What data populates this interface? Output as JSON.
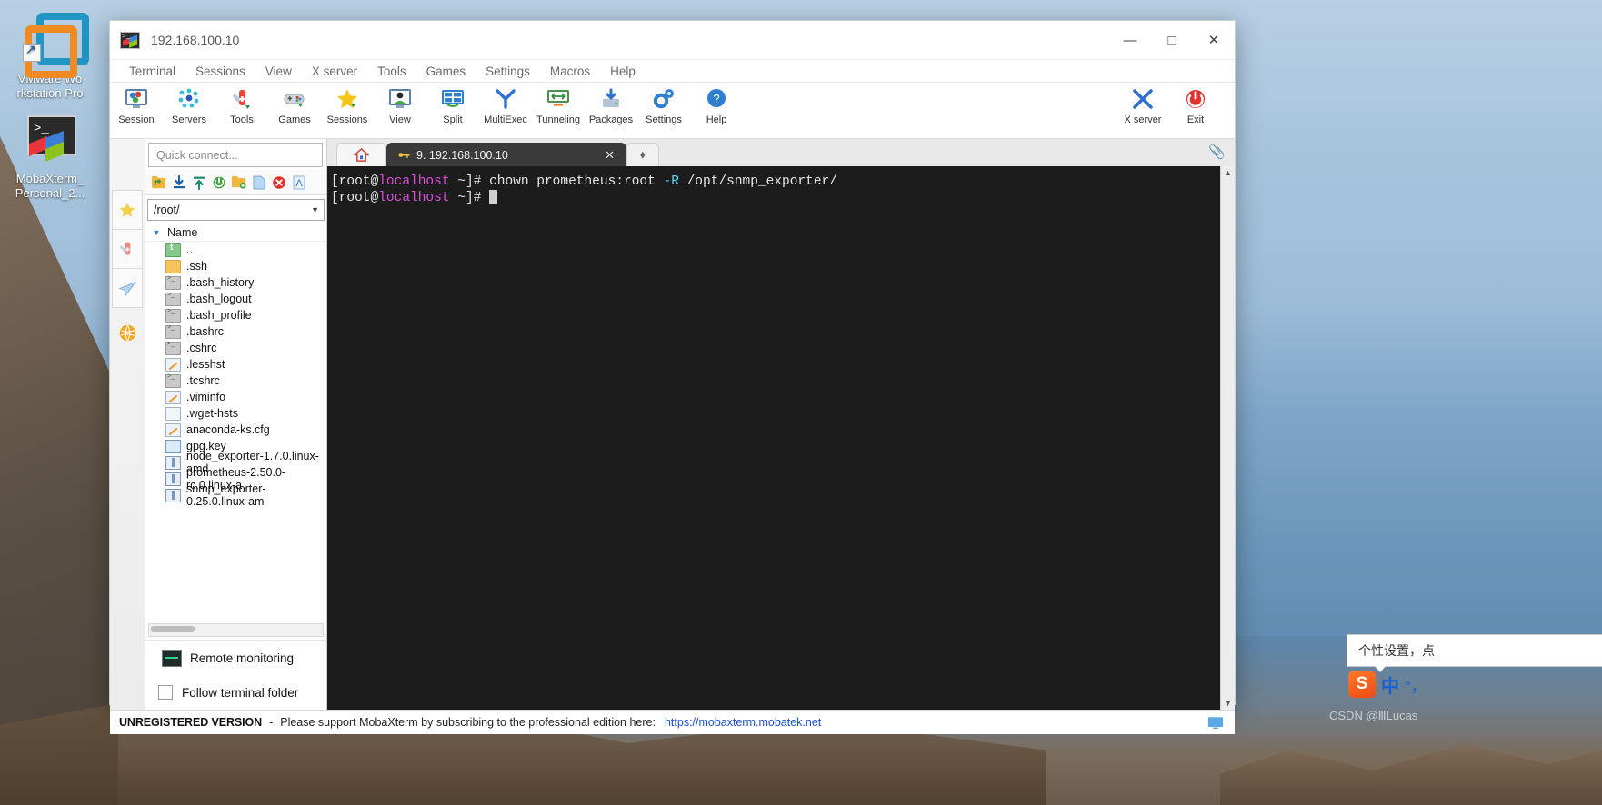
{
  "desktop": {
    "icons": [
      {
        "name": "vmware",
        "label": "VMware Wo\nrkstation Pro"
      },
      {
        "name": "mobaxterm",
        "label": "MobaXterm_\nPersonal_2..."
      }
    ]
  },
  "window": {
    "title": "192.168.100.10",
    "controls": {
      "minimize": "—",
      "maximize": "□",
      "close": "✕"
    },
    "menu": [
      "Terminal",
      "Sessions",
      "View",
      "X server",
      "Tools",
      "Games",
      "Settings",
      "Macros",
      "Help"
    ],
    "toolbar": [
      {
        "icon": "session-icon",
        "label": "Session"
      },
      {
        "icon": "servers-icon",
        "label": "Servers"
      },
      {
        "icon": "tools-icon",
        "label": "Tools"
      },
      {
        "icon": "games-icon",
        "label": "Games"
      },
      {
        "icon": "sessions-star-icon",
        "label": "Sessions"
      },
      {
        "icon": "view-icon",
        "label": "View"
      },
      {
        "icon": "split-icon",
        "label": "Split"
      },
      {
        "icon": "multiexec-icon",
        "label": "MultiExec"
      },
      {
        "icon": "tunneling-icon",
        "label": "Tunneling"
      },
      {
        "icon": "packages-icon",
        "label": "Packages"
      },
      {
        "icon": "settings-icon",
        "label": "Settings"
      },
      {
        "icon": "help-icon",
        "label": "Help"
      }
    ],
    "toolbar_right": [
      {
        "icon": "x-server-icon",
        "label": "X server"
      },
      {
        "icon": "exit-icon",
        "label": "Exit"
      }
    ]
  },
  "sidebar": {
    "quick_connect_placeholder": "Quick connect...",
    "rail_icons": [
      "star-icon",
      "swiss-knife-icon",
      "paper-plane-icon",
      "globe-icon"
    ],
    "sftp_tools": [
      "up-folder-icon",
      "download-icon",
      "upload-icon",
      "refresh-icon",
      "new-folder-icon",
      "new-file-icon",
      "delete-icon",
      "text-mode-icon"
    ],
    "path": "/root/",
    "column_header": "Name",
    "files": [
      {
        "icon": "parent-dir-icon",
        "name": ".."
      },
      {
        "icon": "folder-icon",
        "name": ".ssh"
      },
      {
        "icon": "shell-file-icon",
        "name": ".bash_history"
      },
      {
        "icon": "shell-file-icon",
        "name": ".bash_logout"
      },
      {
        "icon": "shell-file-icon",
        "name": ".bash_profile"
      },
      {
        "icon": "shell-file-icon",
        "name": ".bashrc"
      },
      {
        "icon": "shell-file-icon",
        "name": ".cshrc"
      },
      {
        "icon": "edit-file-icon",
        "name": ".lesshst"
      },
      {
        "icon": "shell-file-icon",
        "name": ".tcshrc"
      },
      {
        "icon": "edit-file-icon",
        "name": ".viminfo"
      },
      {
        "icon": "plain-file-icon",
        "name": ".wget-hsts"
      },
      {
        "icon": "edit-file-icon",
        "name": "anaconda-ks.cfg"
      },
      {
        "icon": "blue-file-icon",
        "name": "gpg.key"
      },
      {
        "icon": "archive-file-icon",
        "name": "node_exporter-1.7.0.linux-amd"
      },
      {
        "icon": "archive-file-icon",
        "name": "prometheus-2.50.0-rc.0.linux-a"
      },
      {
        "icon": "archive-file-icon",
        "name": "snmp_exporter-0.25.0.linux-am"
      }
    ],
    "remote_monitoring": "Remote monitoring",
    "follow_terminal_folder": "Follow terminal folder"
  },
  "tabs": {
    "home_icon": "home-icon",
    "items": [
      {
        "label": "9. 192.168.100.10",
        "icon": "ssh-key-icon",
        "active": true,
        "close": "✕"
      }
    ],
    "new_tab": "⬧"
  },
  "terminal": {
    "lines": [
      {
        "prompt_open": "[root@",
        "host": "localhost",
        "prompt_close": " ~]# ",
        "cmd_a": "chown prometheus:root ",
        "flag": "-R",
        "cmd_b": " /opt/snmp_exporter/"
      },
      {
        "prompt_open": "[root@",
        "host": "localhost",
        "prompt_close": " ~]# ",
        "cmd_a": "",
        "flag": "",
        "cmd_b": ""
      }
    ]
  },
  "status": {
    "unregistered": "UNREGISTERED VERSION",
    "dash": "-",
    "message": "Please support MobaXterm by subscribing to the professional edition here:",
    "link": "https://mobaxterm.mobatek.net",
    "right_icon": "monitor-icon"
  },
  "tray": {
    "tooltip": "个性设置，点",
    "ime_logo": "S",
    "ime_mode": "中",
    "ime_punct": "°，",
    "watermark": "CSDN @ⅢLucas"
  },
  "colors": {
    "accent": "#1a4fd1",
    "terminal_bg": "#1c1c1c",
    "prompt_host": "#d94fd9",
    "flag": "#5fd7ff"
  }
}
